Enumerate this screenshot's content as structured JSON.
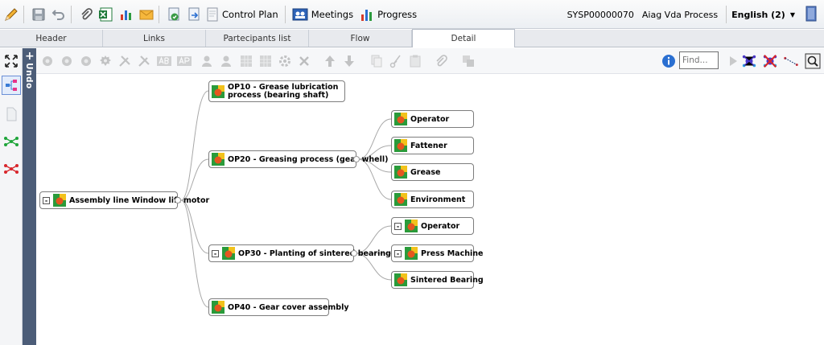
{
  "toolbar": {
    "control_plan_label": "Control Plan",
    "meetings_label": "Meetings",
    "progress_label": "Progress",
    "code": "SYSP00000070",
    "process_name": "Aiag Vda Process",
    "language": "English (2)"
  },
  "tabs": [
    {
      "label": "Header"
    },
    {
      "label": "Links"
    },
    {
      "label": "Partecipants list"
    },
    {
      "label": "Flow"
    },
    {
      "label": "Detail",
      "active": true
    }
  ],
  "undo": {
    "label": "Undo"
  },
  "search": {
    "placeholder": "Find..."
  },
  "tree": {
    "root": {
      "label": "Assembly line Window lift motor"
    },
    "operations": [
      {
        "label": "OP10 - Grease lubrication process (bearing shaft)",
        "children": []
      },
      {
        "label": "OP20 - Greasing process (gear whell)",
        "children": [
          {
            "label": "Operator"
          },
          {
            "label": "Fattener"
          },
          {
            "label": "Grease"
          },
          {
            "label": "Environment"
          }
        ]
      },
      {
        "label": "OP30 - Planting of sintered bearing",
        "children": [
          {
            "label": "Operator"
          },
          {
            "label": "Press Machine"
          },
          {
            "label": "Sintered Bearing"
          }
        ]
      },
      {
        "label": "OP40 - Gear cover assembly",
        "children": []
      }
    ]
  },
  "colors": {
    "undo_bar": "#4c5d78",
    "accent_blue": "#2a6fd1",
    "link_line": "#a8a8a8"
  }
}
